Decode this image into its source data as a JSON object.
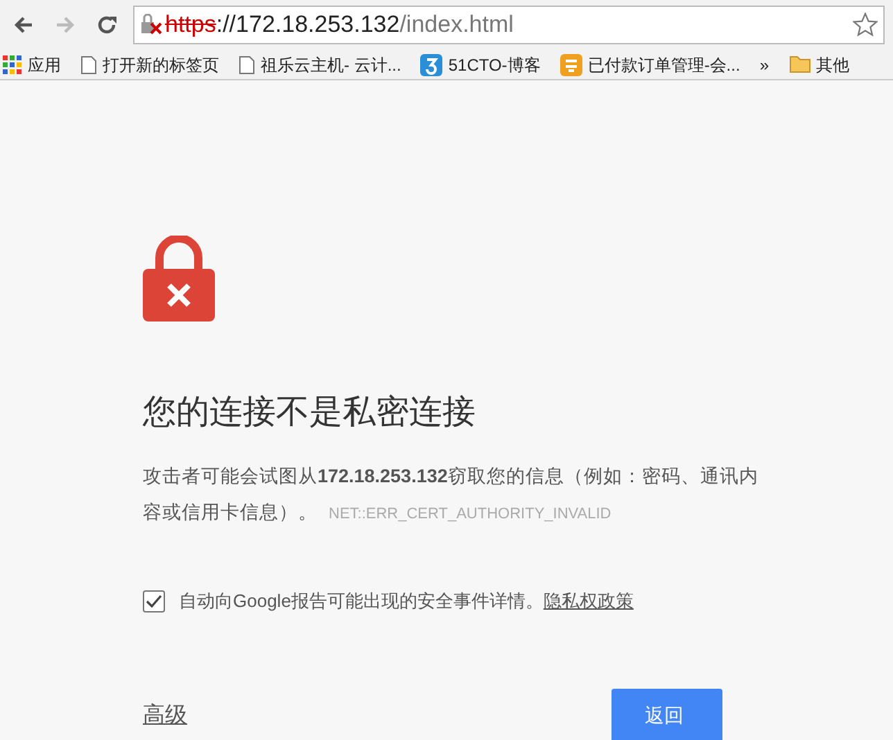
{
  "toolbar": {
    "url_scheme": "https",
    "url_host": "://172.18.253.132",
    "url_path": "/index.html",
    "insecure": true
  },
  "bookmarks": [
    {
      "kind": "apps",
      "label": "应用"
    },
    {
      "kind": "page",
      "label": "打开新的标签页"
    },
    {
      "kind": "page",
      "label": "祖乐云主机- 云计..."
    },
    {
      "kind": "blue",
      "label": "51CTO-博客"
    },
    {
      "kind": "orange",
      "label": "已付款订单管理-会..."
    },
    {
      "kind": "more",
      "label": "»"
    },
    {
      "kind": "folder",
      "label": "其他"
    }
  ],
  "heading": "您的连接不是私密连接",
  "message": "攻击者可能会试图从**172.18.253.132**窃取您的信息（例如：密码、通讯内容或信用卡信息）。",
  "error_code": "NET::ERR_CERT_AUTHORITY_INVALID",
  "report": {
    "checked": true,
    "label": "自动向Google报告可能出现的安全事件详情。",
    "link": "隐私权政策"
  },
  "advanced_link": "高级",
  "back_button": "返回"
}
